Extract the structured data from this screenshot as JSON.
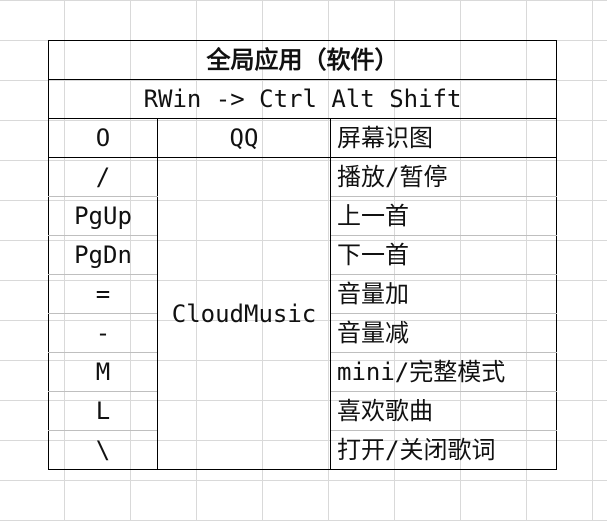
{
  "sheet": {
    "title": "全局应用（软件）",
    "subtitle": "RWin -> Ctrl Alt Shift",
    "headers": [
      "O",
      "QQ",
      "屏幕识图"
    ],
    "app_name": "CloudMusic",
    "rows": [
      {
        "key": "/",
        "function": "播放/暂停"
      },
      {
        "key": "PgUp",
        "function": "上一首"
      },
      {
        "key": "PgDn",
        "function": "下一首"
      },
      {
        "key": "=",
        "function": "音量加"
      },
      {
        "key": "-",
        "function": "音量减"
      },
      {
        "key": "M",
        "function": "mini/完整模式"
      },
      {
        "key": "L",
        "function": "喜欢歌曲"
      },
      {
        "key": "\\",
        "function": "打开/关闭歌词"
      }
    ]
  }
}
